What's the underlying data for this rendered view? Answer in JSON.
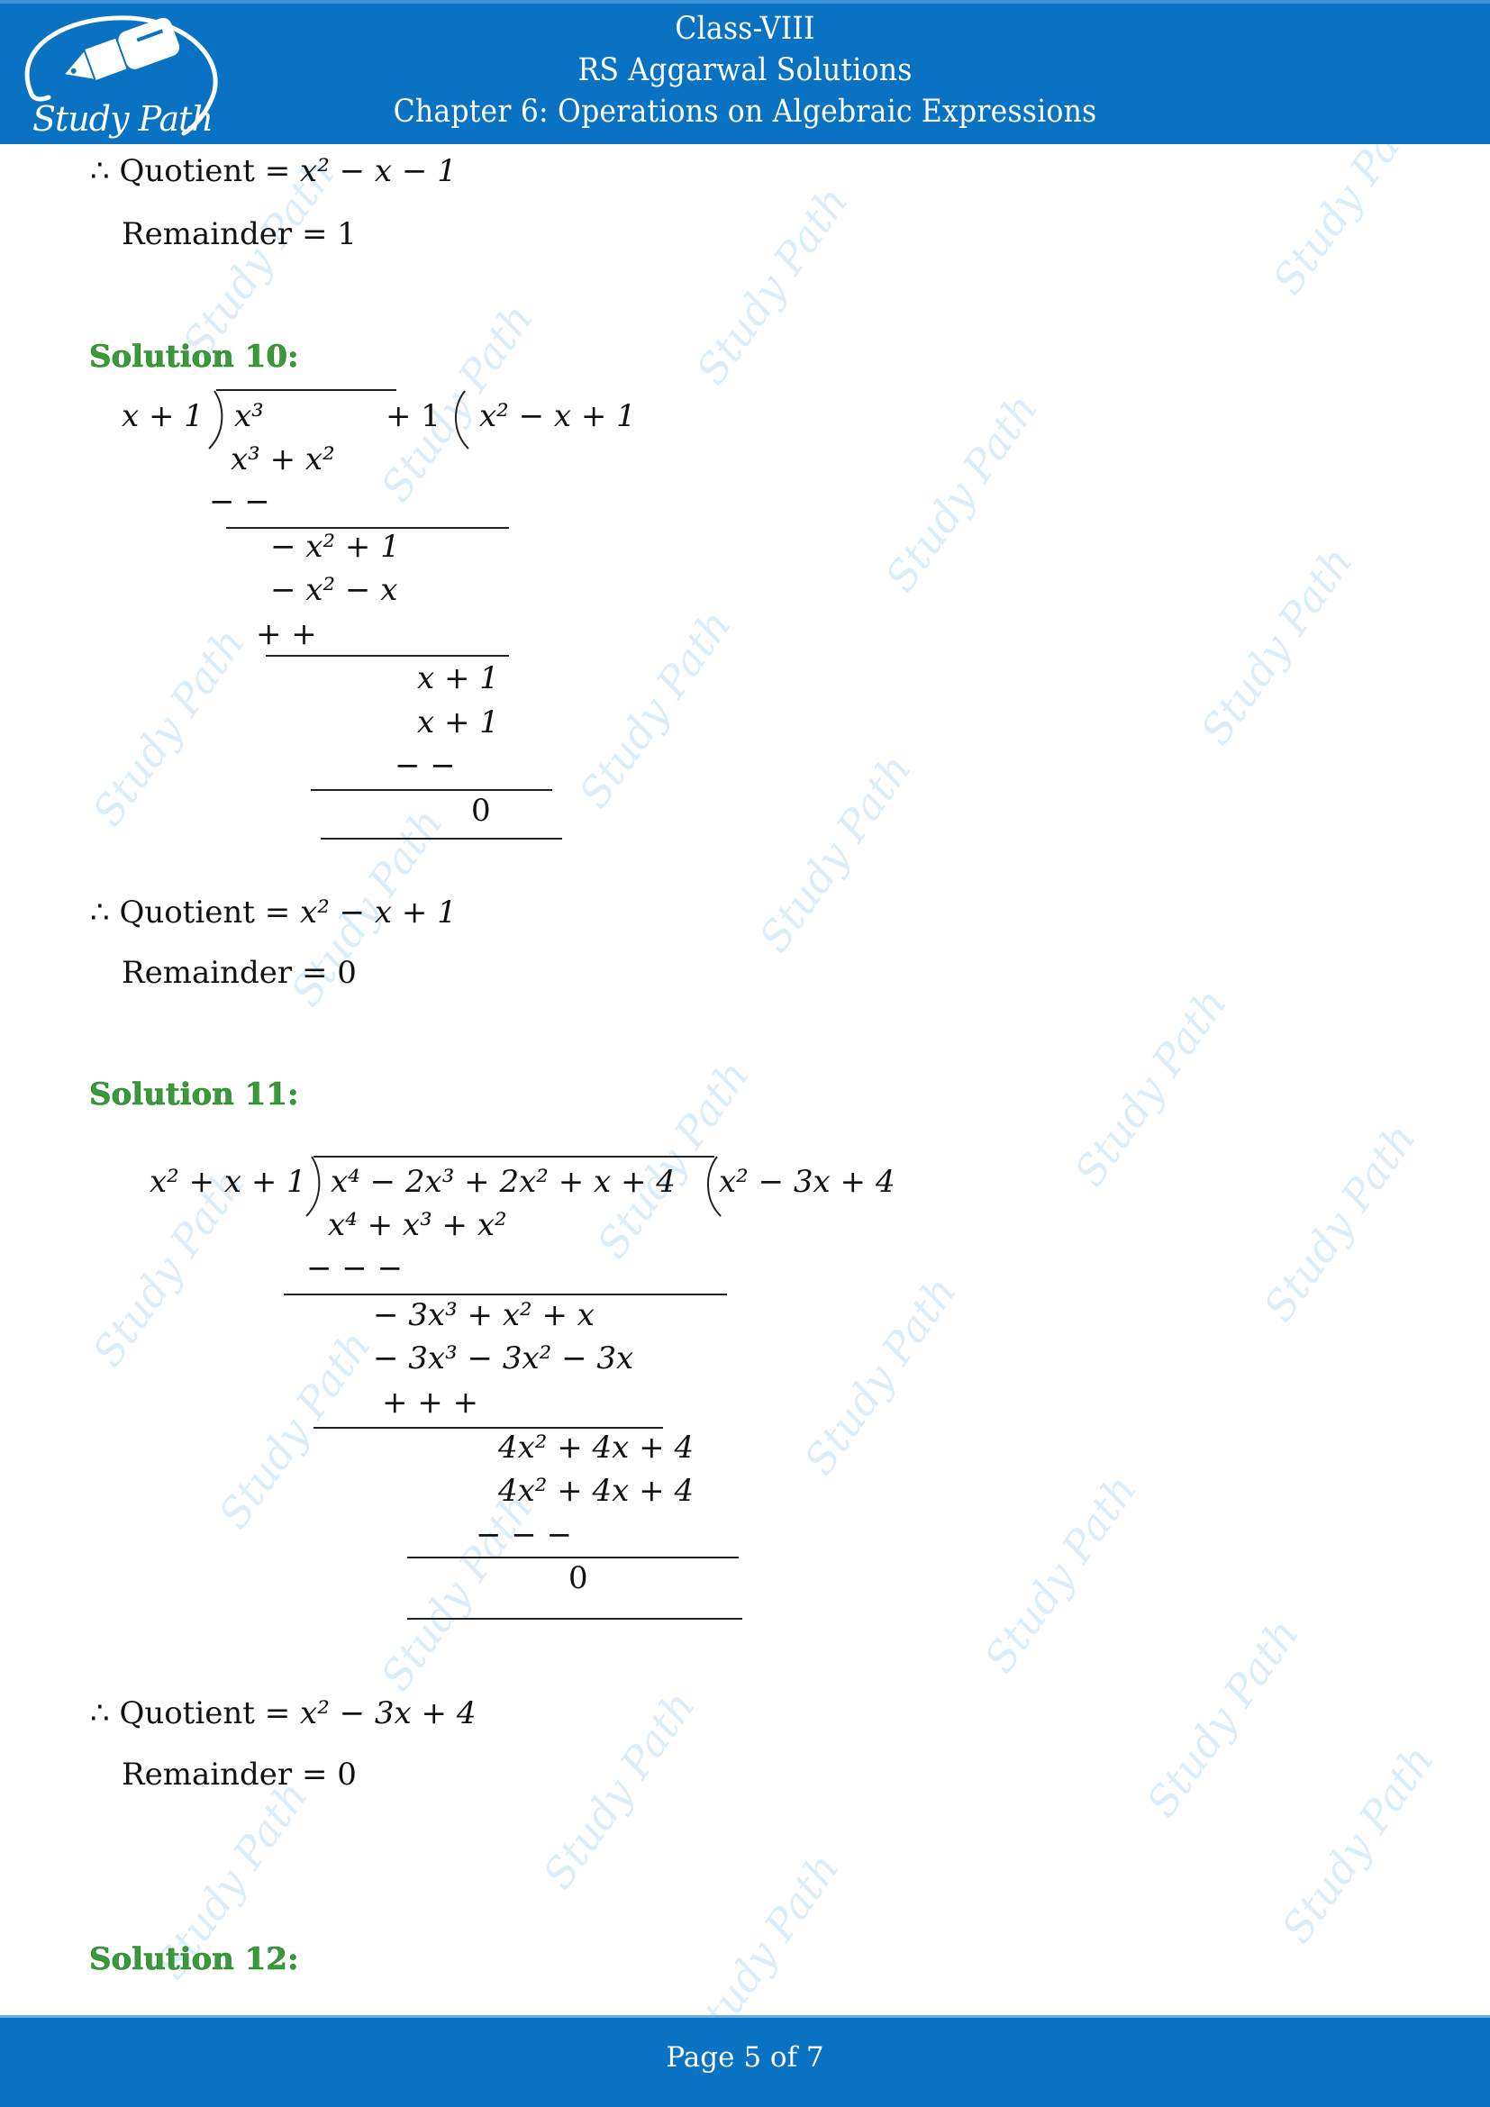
{
  "header": {
    "brand": "Study Path",
    "line1": "Class-VIII",
    "line2": "RS Aggarwal Solutions",
    "line3": "Chapter 6: Operations on Algebraic Expressions"
  },
  "watermark_text": "Study Path",
  "prev_solution": {
    "quotient_label": "∴ Quotient = ",
    "quotient_value": "x² − x − 1",
    "remainder_label": "Remainder = ",
    "remainder_value": "1"
  },
  "solution10": {
    "heading": "Solution 10:",
    "divisor": "x + 1",
    "dividend_terms": [
      "x³",
      "+ 1"
    ],
    "quotient": "x² − x + 1",
    "steps": [
      "x³ + x²",
      "−   −",
      "− x² + 1",
      "− x² − x",
      "+        +",
      "x + 1",
      "x + 1",
      "−   −",
      "0"
    ],
    "result_quotient_label": "∴ Quotient = ",
    "result_quotient_value": "x² − x + 1",
    "result_remainder_label": "Remainder = ",
    "result_remainder_value": "0"
  },
  "solution11": {
    "heading": "Solution 11:",
    "divisor": "x² + x + 1",
    "dividend": "x⁴ − 2x³ + 2x² + x + 4",
    "quotient": "x² − 3x + 4",
    "steps": [
      "x⁴  + x³   +   x²",
      "−     −       −",
      "− 3x³ +  x²  + x",
      "− 3x³ − 3x² − 3x",
      "+        +        +",
      "4x² + 4x + 4",
      "4x² + 4x + 4",
      "−        −        −",
      "0"
    ],
    "result_quotient_label": "∴ Quotient = ",
    "result_quotient_value": "x² − 3x + 4",
    "result_remainder_label": "Remainder = ",
    "result_remainder_value": "0"
  },
  "solution12": {
    "heading": "Solution 12:"
  },
  "footer": {
    "page_label": "Page 5 of 7",
    "current_page": 5,
    "total_pages": 7
  },
  "colors": {
    "header_bg": "#0a72c2",
    "heading_green": "#3a9a3a",
    "watermark": "#cfe8f7"
  }
}
